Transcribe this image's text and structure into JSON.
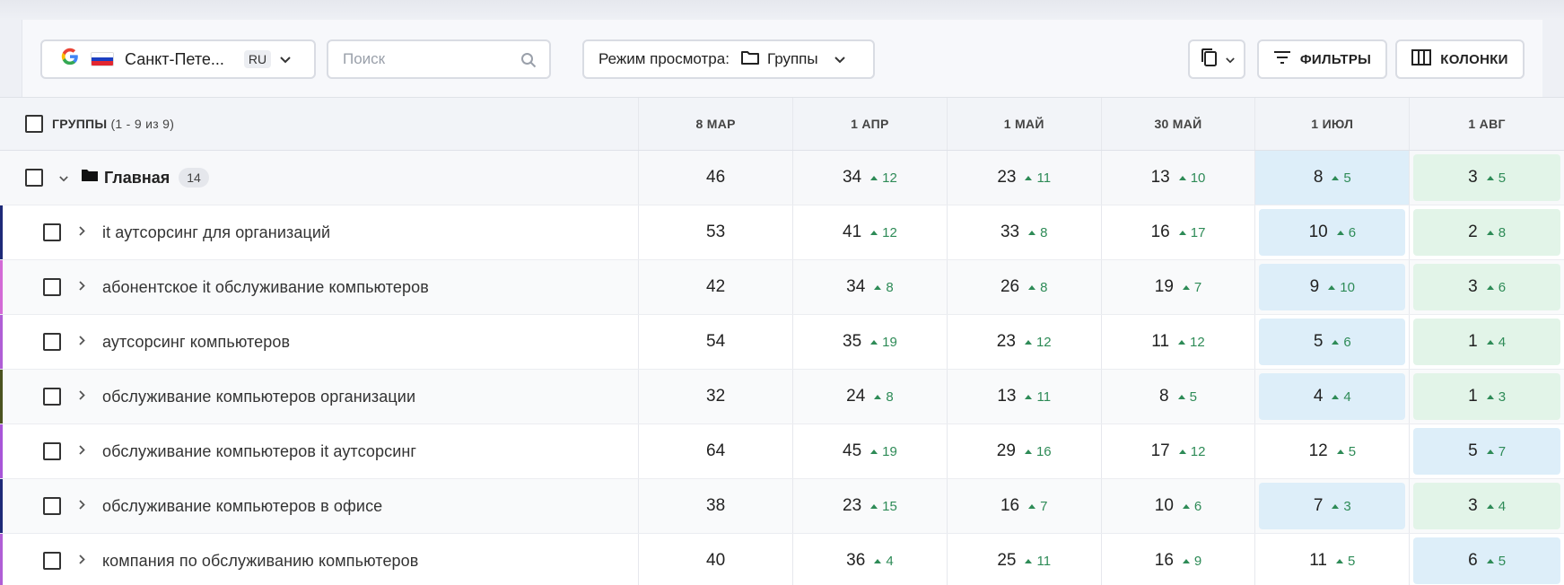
{
  "toolbar": {
    "location": {
      "engine": "G",
      "city": "Санкт-Пете...",
      "lang": "RU",
      "flag_colors": [
        "#ffffff",
        "#1c3fc2",
        "#e3262f"
      ]
    },
    "search": {
      "placeholder": "Поиск",
      "value": ""
    },
    "view": {
      "label": "Режим просмотра:",
      "value": "Группы"
    },
    "filters_label": "ФИЛЬТРЫ",
    "columns_label": "КОЛОНКИ"
  },
  "table": {
    "header": {
      "title": "ГРУППЫ",
      "count": "(1 - 9 из 9)",
      "dates": [
        "8 МАР",
        "1 АПР",
        "1 МАЙ",
        "30 МАЙ",
        "1 ИЮЛ",
        "1 АВГ"
      ]
    },
    "group": {
      "name": "Главная",
      "badge": "14",
      "cells": [
        {
          "v": "46",
          "d": ""
        },
        {
          "v": "34",
          "d": "12"
        },
        {
          "v": "23",
          "d": "11"
        },
        {
          "v": "13",
          "d": "10"
        },
        {
          "v": "8",
          "d": "5",
          "hl": "blue-full"
        },
        {
          "v": "3",
          "d": "5",
          "hl": "green"
        }
      ]
    },
    "rows": [
      {
        "name": "it аутсорсинг для организаций",
        "stripe": "#1e2a78",
        "cells": [
          {
            "v": "53",
            "d": ""
          },
          {
            "v": "41",
            "d": "12"
          },
          {
            "v": "33",
            "d": "8"
          },
          {
            "v": "16",
            "d": "17"
          },
          {
            "v": "10",
            "d": "6",
            "hl": "blue"
          },
          {
            "v": "2",
            "d": "8",
            "hl": "green"
          }
        ]
      },
      {
        "name": "абонентское it обслуживание компьютеров",
        "stripe": "#d36ad6",
        "cells": [
          {
            "v": "42",
            "d": ""
          },
          {
            "v": "34",
            "d": "8"
          },
          {
            "v": "26",
            "d": "8"
          },
          {
            "v": "19",
            "d": "7"
          },
          {
            "v": "9",
            "d": "10",
            "hl": "blue"
          },
          {
            "v": "3",
            "d": "6",
            "hl": "green"
          }
        ]
      },
      {
        "name": "аутсорсинг компьютеров",
        "stripe": "#b05ed6",
        "cells": [
          {
            "v": "54",
            "d": ""
          },
          {
            "v": "35",
            "d": "19"
          },
          {
            "v": "23",
            "d": "12"
          },
          {
            "v": "11",
            "d": "12"
          },
          {
            "v": "5",
            "d": "6",
            "hl": "blue"
          },
          {
            "v": "1",
            "d": "4",
            "hl": "green"
          }
        ]
      },
      {
        "name": "обслуживание компьютеров организации",
        "stripe": "#4b5320",
        "cells": [
          {
            "v": "32",
            "d": ""
          },
          {
            "v": "24",
            "d": "8"
          },
          {
            "v": "13",
            "d": "11"
          },
          {
            "v": "8",
            "d": "5"
          },
          {
            "v": "4",
            "d": "4",
            "hl": "blue"
          },
          {
            "v": "1",
            "d": "3",
            "hl": "green"
          }
        ]
      },
      {
        "name": "обслуживание компьютеров it аутсорсинг",
        "stripe": "#a855d8",
        "cells": [
          {
            "v": "64",
            "d": ""
          },
          {
            "v": "45",
            "d": "19"
          },
          {
            "v": "29",
            "d": "16"
          },
          {
            "v": "17",
            "d": "12"
          },
          {
            "v": "12",
            "d": "5"
          },
          {
            "v": "5",
            "d": "7",
            "hl": "blue"
          }
        ]
      },
      {
        "name": "обслуживание компьютеров в офисе",
        "stripe": "#1e2a78",
        "cells": [
          {
            "v": "38",
            "d": ""
          },
          {
            "v": "23",
            "d": "15"
          },
          {
            "v": "16",
            "d": "7"
          },
          {
            "v": "10",
            "d": "6"
          },
          {
            "v": "7",
            "d": "3",
            "hl": "blue"
          },
          {
            "v": "3",
            "d": "4",
            "hl": "green"
          }
        ]
      },
      {
        "name": "компания по обслуживанию компьютеров",
        "stripe": "#b05ed6",
        "cells": [
          {
            "v": "40",
            "d": ""
          },
          {
            "v": "36",
            "d": "4"
          },
          {
            "v": "25",
            "d": "11"
          },
          {
            "v": "16",
            "d": "9"
          },
          {
            "v": "11",
            "d": "5"
          },
          {
            "v": "6",
            "d": "5",
            "hl": "blue"
          }
        ]
      }
    ]
  }
}
